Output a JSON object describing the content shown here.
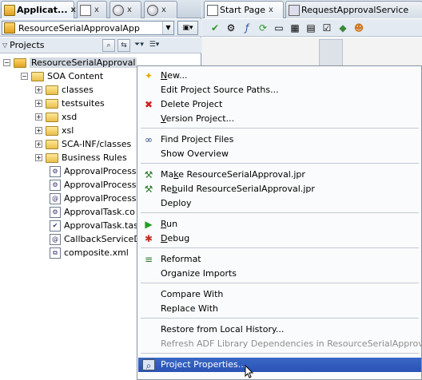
{
  "left_tabs": [
    {
      "label": "Applicat...",
      "icon": "application-icon",
      "close": "x"
    },
    {
      "label": "",
      "icon": "document-icon",
      "close": "x"
    },
    {
      "label": "",
      "icon": "globe-icon",
      "close": "x"
    },
    {
      "label": "",
      "icon": "structure-icon",
      "close": "x"
    }
  ],
  "app_selector": {
    "value": "ResourceSerialApprovalApp"
  },
  "projects_panel": {
    "title": "Projects"
  },
  "tree": {
    "root": "ResourceSerialApproval",
    "soa_content": "SOA Content",
    "items": [
      {
        "label": "classes",
        "type": "folder",
        "expandable": true
      },
      {
        "label": "testsuites",
        "type": "folder",
        "expandable": true
      },
      {
        "label": "xsd",
        "type": "folder",
        "expandable": true
      },
      {
        "label": "xsl",
        "type": "folder",
        "expandable": true
      },
      {
        "label": "SCA-INF/classes",
        "type": "folder",
        "expandable": true
      },
      {
        "label": "Business Rules",
        "type": "folder",
        "expandable": true
      },
      {
        "label": "ApprovalProcess",
        "type": "file",
        "expandable": false
      },
      {
        "label": "ApprovalProcess",
        "type": "file",
        "expandable": false
      },
      {
        "label": "ApprovalProcess",
        "type": "file",
        "expandable": false
      },
      {
        "label": "ApprovalTask.co",
        "type": "file",
        "expandable": false
      },
      {
        "label": "ApprovalTask.tas",
        "type": "file",
        "expandable": false
      },
      {
        "label": "CallbackServiceD",
        "type": "file",
        "expandable": false
      },
      {
        "label": "composite.xml",
        "type": "file",
        "expandable": false
      }
    ]
  },
  "right_tabs": [
    {
      "label": "Start Page",
      "close": "x"
    },
    {
      "label": "RequestApprovalService",
      "close": ""
    }
  ],
  "context_menu": {
    "items": [
      {
        "label": "New...",
        "icon": "new-icon",
        "mnemonic": 0,
        "disabled": false,
        "highlight": false
      },
      {
        "label": "Edit Project Source Paths...",
        "icon": "",
        "mnemonic": -1,
        "disabled": false,
        "highlight": false
      },
      {
        "label": "Delete Project",
        "icon": "delete-icon",
        "mnemonic": -1,
        "disabled": false,
        "highlight": false
      },
      {
        "label": "Version Project...",
        "icon": "",
        "mnemonic": 0,
        "disabled": false,
        "highlight": false
      },
      {
        "label": "Find Project Files",
        "icon": "binoculars-icon",
        "mnemonic": -1,
        "disabled": false,
        "highlight": false
      },
      {
        "label": "Show Overview",
        "icon": "",
        "mnemonic": -1,
        "disabled": false,
        "highlight": false
      },
      {
        "label": "Make ResourceSerialApproval.jpr",
        "icon": "make-icon",
        "mnemonic": 2,
        "disabled": false,
        "highlight": false
      },
      {
        "label": "Rebuild ResourceSerialApproval.jpr",
        "icon": "rebuild-icon",
        "mnemonic": 2,
        "disabled": false,
        "highlight": false
      },
      {
        "label": "Deploy",
        "icon": "",
        "mnemonic": -1,
        "disabled": false,
        "highlight": false
      },
      {
        "label": "Run",
        "icon": "run-icon",
        "mnemonic": 0,
        "disabled": false,
        "highlight": false
      },
      {
        "label": "Debug",
        "icon": "debug-icon",
        "mnemonic": 0,
        "disabled": false,
        "highlight": false
      },
      {
        "label": "Reformat",
        "icon": "reformat-icon",
        "mnemonic": -1,
        "disabled": false,
        "highlight": false
      },
      {
        "label": "Organize Imports",
        "icon": "",
        "mnemonic": -1,
        "disabled": false,
        "highlight": false
      },
      {
        "label": "Compare With",
        "icon": "",
        "mnemonic": -1,
        "disabled": false,
        "highlight": false
      },
      {
        "label": "Replace With",
        "icon": "",
        "mnemonic": -1,
        "disabled": false,
        "highlight": false
      },
      {
        "label": "Restore from Local History...",
        "icon": "",
        "mnemonic": -1,
        "disabled": false,
        "highlight": false
      },
      {
        "label": "Refresh ADF Library Dependencies in ResourceSerialApproval",
        "icon": "",
        "mnemonic": -1,
        "disabled": true,
        "highlight": false
      },
      {
        "label": "Project Properties...",
        "icon": "properties-icon",
        "mnemonic": -1,
        "disabled": false,
        "highlight": true
      }
    ]
  },
  "colors": {
    "highlight": "#2f5bbd",
    "tree_selection": "#d4dae2",
    "pane_border": "#8d9db1"
  }
}
